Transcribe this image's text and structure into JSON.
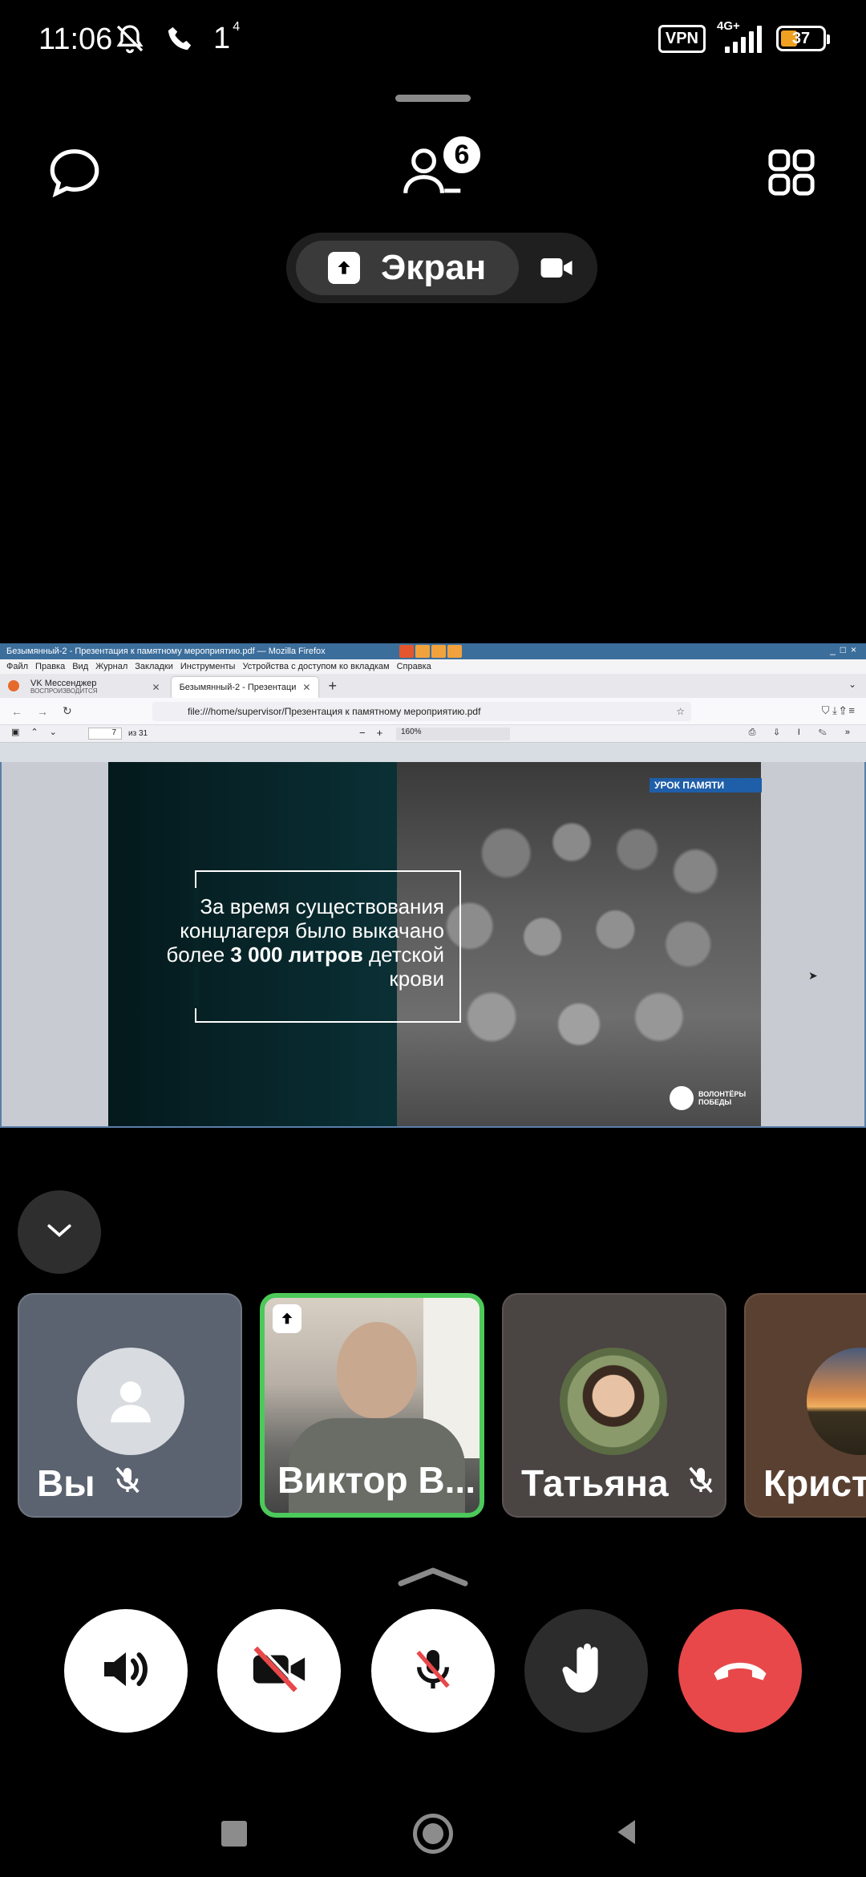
{
  "status_bar": {
    "time": "11:06",
    "network_label": "1",
    "network_sup": "4",
    "vpn": "VPN",
    "lte": "4G+",
    "battery": "37"
  },
  "top": {
    "participants_count": "6",
    "share_label": "Экран",
    "icons": [
      "chat-icon",
      "participants-icon",
      "grid-icon",
      "upload-icon",
      "camera-icon"
    ]
  },
  "screen": {
    "window_title": "Безымянный-2 - Презентация к памятному мероприятию.pdf — Mozilla Firefox",
    "menu": [
      "Файл",
      "Правка",
      "Вид",
      "Журнал",
      "Закладки",
      "Инструменты",
      "Устройства с доступом ко вкладкам",
      "Справка"
    ],
    "tabs": [
      {
        "title": "VK Мессенджер",
        "subtitle": "ВОСПРОИЗВОДИТСЯ"
      },
      {
        "title": "Безымянный-2 - Презентаци"
      }
    ],
    "url": "file:///home/supervisor/Презентация к памятному мероприятию.pdf",
    "pdf": {
      "page": "7",
      "of": "из 31",
      "zoom": "160%"
    },
    "slide": {
      "tag": "УРОК ПАМЯТИ",
      "text_1": "За время существования концлагеря было выкачано более",
      "text_bold_1": "3 000",
      "text_bold_2": "литров",
      "text_2": "детской крови",
      "logo": "ВОЛОНТЁРЫ ПОБЕДЫ"
    }
  },
  "participants": [
    {
      "name": "Вы",
      "muted": true
    },
    {
      "name": "Виктор В...",
      "sharing": true,
      "active": true
    },
    {
      "name": "Татьяна",
      "muted": true
    },
    {
      "name": "Крист"
    }
  ],
  "controls": [
    "speaker-button",
    "camera-off-button",
    "mic-off-button",
    "raise-hand-button",
    "end-call-button"
  ],
  "colors": {
    "active_speaker": "#4cc95a",
    "end_call": "#e8484a",
    "background": "#000000",
    "panel": "#1b1b1b"
  }
}
